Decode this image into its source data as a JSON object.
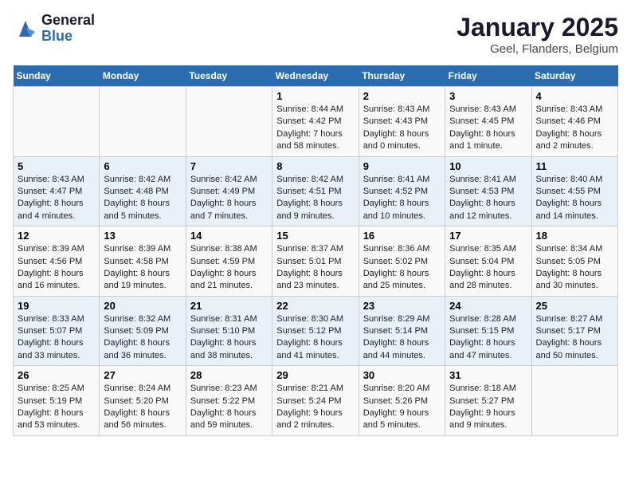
{
  "header": {
    "logo_general": "General",
    "logo_blue": "Blue",
    "title": "January 2025",
    "subtitle": "Geel, Flanders, Belgium"
  },
  "days_of_week": [
    "Sunday",
    "Monday",
    "Tuesday",
    "Wednesday",
    "Thursday",
    "Friday",
    "Saturday"
  ],
  "weeks": [
    [
      {
        "day": "",
        "info": ""
      },
      {
        "day": "",
        "info": ""
      },
      {
        "day": "",
        "info": ""
      },
      {
        "day": "1",
        "info": "Sunrise: 8:44 AM\nSunset: 4:42 PM\nDaylight: 7 hours\nand 58 minutes."
      },
      {
        "day": "2",
        "info": "Sunrise: 8:43 AM\nSunset: 4:43 PM\nDaylight: 8 hours\nand 0 minutes."
      },
      {
        "day": "3",
        "info": "Sunrise: 8:43 AM\nSunset: 4:45 PM\nDaylight: 8 hours\nand 1 minute."
      },
      {
        "day": "4",
        "info": "Sunrise: 8:43 AM\nSunset: 4:46 PM\nDaylight: 8 hours\nand 2 minutes."
      }
    ],
    [
      {
        "day": "5",
        "info": "Sunrise: 8:43 AM\nSunset: 4:47 PM\nDaylight: 8 hours\nand 4 minutes."
      },
      {
        "day": "6",
        "info": "Sunrise: 8:42 AM\nSunset: 4:48 PM\nDaylight: 8 hours\nand 5 minutes."
      },
      {
        "day": "7",
        "info": "Sunrise: 8:42 AM\nSunset: 4:49 PM\nDaylight: 8 hours\nand 7 minutes."
      },
      {
        "day": "8",
        "info": "Sunrise: 8:42 AM\nSunset: 4:51 PM\nDaylight: 8 hours\nand 9 minutes."
      },
      {
        "day": "9",
        "info": "Sunrise: 8:41 AM\nSunset: 4:52 PM\nDaylight: 8 hours\nand 10 minutes."
      },
      {
        "day": "10",
        "info": "Sunrise: 8:41 AM\nSunset: 4:53 PM\nDaylight: 8 hours\nand 12 minutes."
      },
      {
        "day": "11",
        "info": "Sunrise: 8:40 AM\nSunset: 4:55 PM\nDaylight: 8 hours\nand 14 minutes."
      }
    ],
    [
      {
        "day": "12",
        "info": "Sunrise: 8:39 AM\nSunset: 4:56 PM\nDaylight: 8 hours\nand 16 minutes."
      },
      {
        "day": "13",
        "info": "Sunrise: 8:39 AM\nSunset: 4:58 PM\nDaylight: 8 hours\nand 19 minutes."
      },
      {
        "day": "14",
        "info": "Sunrise: 8:38 AM\nSunset: 4:59 PM\nDaylight: 8 hours\nand 21 minutes."
      },
      {
        "day": "15",
        "info": "Sunrise: 8:37 AM\nSunset: 5:01 PM\nDaylight: 8 hours\nand 23 minutes."
      },
      {
        "day": "16",
        "info": "Sunrise: 8:36 AM\nSunset: 5:02 PM\nDaylight: 8 hours\nand 25 minutes."
      },
      {
        "day": "17",
        "info": "Sunrise: 8:35 AM\nSunset: 5:04 PM\nDaylight: 8 hours\nand 28 minutes."
      },
      {
        "day": "18",
        "info": "Sunrise: 8:34 AM\nSunset: 5:05 PM\nDaylight: 8 hours\nand 30 minutes."
      }
    ],
    [
      {
        "day": "19",
        "info": "Sunrise: 8:33 AM\nSunset: 5:07 PM\nDaylight: 8 hours\nand 33 minutes."
      },
      {
        "day": "20",
        "info": "Sunrise: 8:32 AM\nSunset: 5:09 PM\nDaylight: 8 hours\nand 36 minutes."
      },
      {
        "day": "21",
        "info": "Sunrise: 8:31 AM\nSunset: 5:10 PM\nDaylight: 8 hours\nand 38 minutes."
      },
      {
        "day": "22",
        "info": "Sunrise: 8:30 AM\nSunset: 5:12 PM\nDaylight: 8 hours\nand 41 minutes."
      },
      {
        "day": "23",
        "info": "Sunrise: 8:29 AM\nSunset: 5:14 PM\nDaylight: 8 hours\nand 44 minutes."
      },
      {
        "day": "24",
        "info": "Sunrise: 8:28 AM\nSunset: 5:15 PM\nDaylight: 8 hours\nand 47 minutes."
      },
      {
        "day": "25",
        "info": "Sunrise: 8:27 AM\nSunset: 5:17 PM\nDaylight: 8 hours\nand 50 minutes."
      }
    ],
    [
      {
        "day": "26",
        "info": "Sunrise: 8:25 AM\nSunset: 5:19 PM\nDaylight: 8 hours\nand 53 minutes."
      },
      {
        "day": "27",
        "info": "Sunrise: 8:24 AM\nSunset: 5:20 PM\nDaylight: 8 hours\nand 56 minutes."
      },
      {
        "day": "28",
        "info": "Sunrise: 8:23 AM\nSunset: 5:22 PM\nDaylight: 8 hours\nand 59 minutes."
      },
      {
        "day": "29",
        "info": "Sunrise: 8:21 AM\nSunset: 5:24 PM\nDaylight: 9 hours\nand 2 minutes."
      },
      {
        "day": "30",
        "info": "Sunrise: 8:20 AM\nSunset: 5:26 PM\nDaylight: 9 hours\nand 5 minutes."
      },
      {
        "day": "31",
        "info": "Sunrise: 8:18 AM\nSunset: 5:27 PM\nDaylight: 9 hours\nand 9 minutes."
      },
      {
        "day": "",
        "info": ""
      }
    ]
  ]
}
